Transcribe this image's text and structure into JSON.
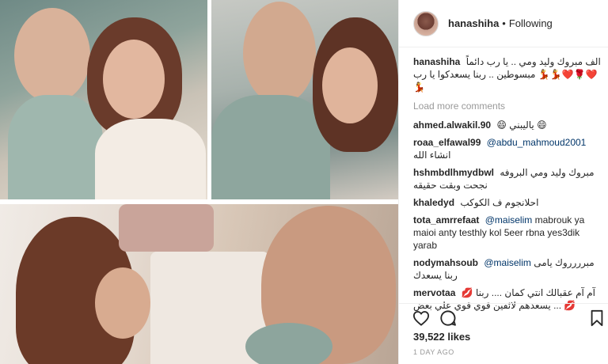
{
  "post": {
    "username": "hanashiha",
    "follow_separator": "•",
    "follow_status": "Following",
    "caption": "الف مبروك وليد ومي .. يا رب دائماً ❤️🌹❤️💃💃 مبسوطين .. ربنا يسعدكوا يا رب 💃",
    "load_more": "Load more comments",
    "comments": [
      {
        "user": "ahmed.alwakil.90",
        "text": "😄 ياليبني 😄",
        "mention": ""
      },
      {
        "user": "roaa_elfawal99",
        "mention": "@abdu_mahmoud2001",
        "text": "انشاء الله"
      },
      {
        "user": "hshmbdlhmydbwl",
        "text": "مبروك وليد ومي البروفه نجحت وبقت حقيقه",
        "mention": ""
      },
      {
        "user": "khaledyd",
        "text": "احلانجوم ف الكوكب",
        "mention": ""
      },
      {
        "user": "tota_amrrefaat",
        "mention": "@maiselim",
        "text": "mabrouk ya maioi anty testhly kol 5eer rbna yes3dik yarab"
      },
      {
        "user": "nodymahsoub",
        "mention": "@maiselim",
        "text": "مبرررروك يامى ربنا يسعدك"
      },
      {
        "user": "mervotaa",
        "text": "آم آم عقبالك انتي كمان .... ربنا 💋💋 ... يسعدهم لائقين قوي قوي علي بعض",
        "mention": ""
      }
    ],
    "likes": "39,522 likes",
    "time": "1 DAY AGO"
  },
  "icons": {
    "like": "heart-outline-icon",
    "comment": "comment-bubble-icon",
    "save": "bookmark-icon"
  },
  "colors": {
    "text": "#262626",
    "muted": "#999999",
    "mention": "#003569",
    "border": "#efefef"
  }
}
